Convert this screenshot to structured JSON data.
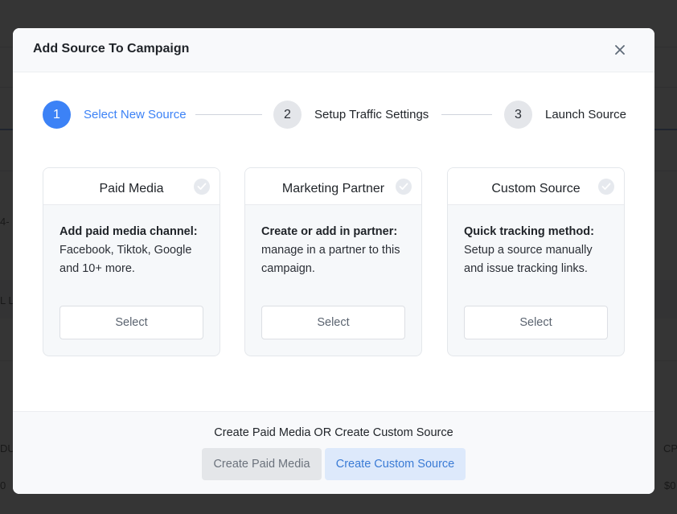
{
  "modal": {
    "title": "Add Source To Campaign",
    "close_icon": "close-icon"
  },
  "stepper": {
    "steps": [
      {
        "number": "1",
        "label": "Select New Source",
        "active": true
      },
      {
        "number": "2",
        "label": "Setup Traffic Settings",
        "active": false
      },
      {
        "number": "3",
        "label": "Launch Source",
        "active": false
      }
    ]
  },
  "cards": [
    {
      "title": "Paid Media",
      "heading": "Add paid media channel:",
      "description": "Facebook, Tiktok, Google and 10+ more.",
      "select_label": "Select",
      "check_icon": "check-circle-icon"
    },
    {
      "title": "Marketing Partner",
      "heading": "Create or add in partner:",
      "description": "manage in a partner to this campaign.",
      "select_label": "Select",
      "check_icon": "check-circle-icon"
    },
    {
      "title": "Custom Source",
      "heading": "Quick tracking method:",
      "description": "Setup a source manually and issue tracking links.",
      "select_label": "Select",
      "check_icon": "check-circle-icon"
    }
  ],
  "footer": {
    "caption": "Create Paid Media OR Create Custom Source",
    "paid_media_button": "Create Paid Media",
    "custom_source_button": "Create Custom Source"
  },
  "background": {
    "fragments": [
      "4-",
      "L L",
      "DU",
      "0",
      "CP",
      "$0"
    ]
  },
  "colors": {
    "accent": "#3c82f6",
    "overlay": "#141414",
    "custom_button_bg": "#dde9fb",
    "custom_button_text": "#3a7bd5"
  }
}
